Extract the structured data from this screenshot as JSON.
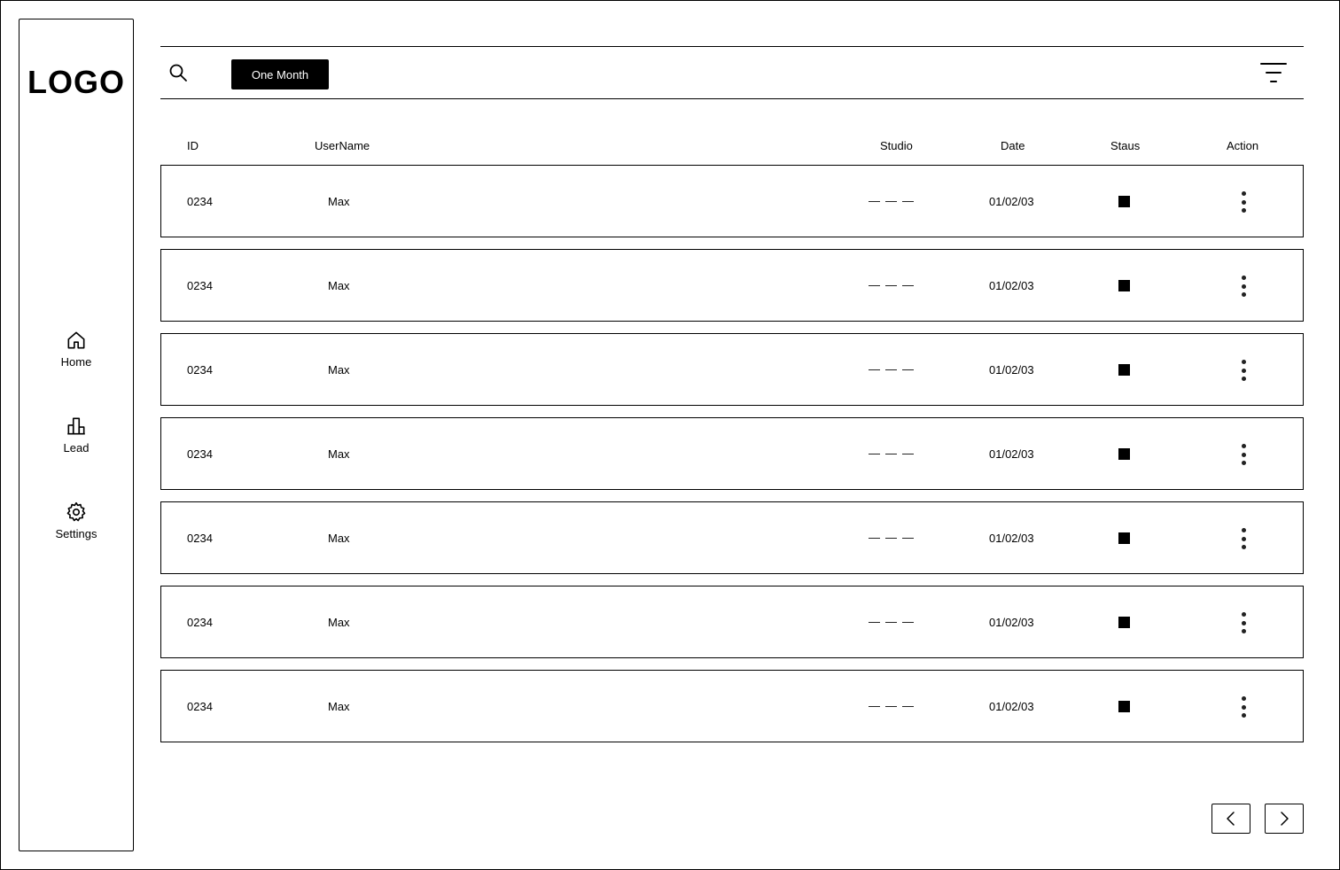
{
  "sidebar": {
    "logo": "LOGO",
    "items": [
      {
        "label": "Home",
        "icon": "home-icon"
      },
      {
        "label": "Lead",
        "icon": "chart-icon"
      },
      {
        "label": "Settings",
        "icon": "gear-icon"
      }
    ]
  },
  "toolbar": {
    "period_label": "One Month",
    "search_icon": "search-icon",
    "filter_icon": "filter-icon"
  },
  "table": {
    "columns": [
      "ID",
      "UserName",
      "Studio",
      "Date",
      "Staus",
      "Action"
    ],
    "rows": [
      {
        "id": "0234",
        "username": "Max",
        "studio": "———",
        "date": "01/02/03"
      },
      {
        "id": "0234",
        "username": "Max",
        "studio": "———",
        "date": "01/02/03"
      },
      {
        "id": "0234",
        "username": "Max",
        "studio": "———",
        "date": "01/02/03"
      },
      {
        "id": "0234",
        "username": "Max",
        "studio": "———",
        "date": "01/02/03"
      },
      {
        "id": "0234",
        "username": "Max",
        "studio": "———",
        "date": "01/02/03"
      },
      {
        "id": "0234",
        "username": "Max",
        "studio": "———",
        "date": "01/02/03"
      },
      {
        "id": "0234",
        "username": "Max",
        "studio": "———",
        "date": "01/02/03"
      }
    ]
  },
  "pagination": {
    "prev_icon": "chevron-left-icon",
    "next_icon": "chevron-right-icon"
  },
  "colors": {
    "primary": "#000000",
    "background": "#ffffff"
  }
}
